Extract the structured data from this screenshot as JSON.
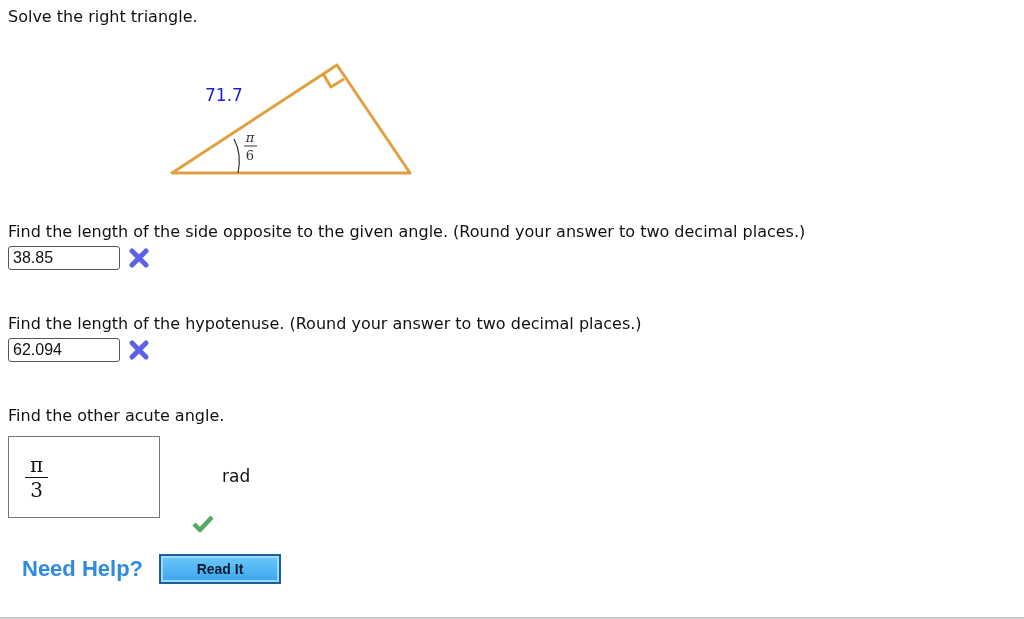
{
  "prompt": "Solve the right triangle.",
  "figure": {
    "side_label": "71.7",
    "angle_numerator": "π",
    "angle_denominator": "6"
  },
  "questions": [
    {
      "kind": "text",
      "text": "Find the length of the side opposite to the given angle. (Round your answer to two decimal places.)",
      "value": "38.85",
      "correct": false
    },
    {
      "kind": "text",
      "text": "Find the length of the hypotenuse. (Round your answer to two decimal places.)",
      "value": "62.094",
      "correct": false
    },
    {
      "kind": "fraction",
      "text": "Find the other acute angle.",
      "numerator": "π",
      "denominator": "3",
      "unit": "rad",
      "correct": true
    }
  ],
  "help": {
    "label": "Need Help?",
    "button": "Read It"
  }
}
